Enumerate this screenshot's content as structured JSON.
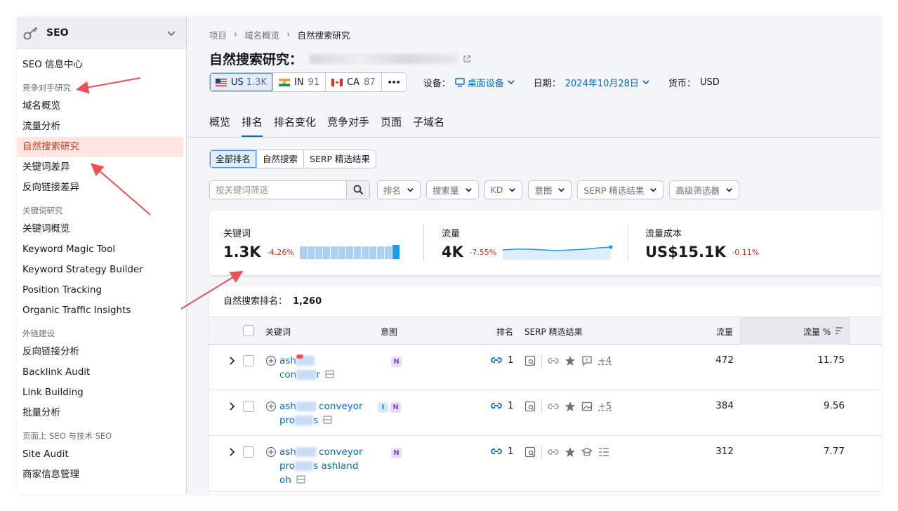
{
  "sidebar": {
    "title": "SEO",
    "items": [
      {
        "type": "item",
        "label": "SEO 信息中心"
      },
      {
        "type": "section",
        "label": "竞争对手研究"
      },
      {
        "type": "item",
        "label": "域名概览"
      },
      {
        "type": "item",
        "label": "流量分析"
      },
      {
        "type": "item",
        "label": "自然搜索研究",
        "active": true
      },
      {
        "type": "item",
        "label": "关键词差异"
      },
      {
        "type": "item",
        "label": "反向链接差异"
      },
      {
        "type": "section",
        "label": "关键词研究"
      },
      {
        "type": "item",
        "label": "关键词概览"
      },
      {
        "type": "item",
        "label": "Keyword Magic Tool"
      },
      {
        "type": "item",
        "label": "Keyword Strategy Builder"
      },
      {
        "type": "item",
        "label": "Position Tracking"
      },
      {
        "type": "item",
        "label": "Organic Traffic Insights"
      },
      {
        "type": "section",
        "label": "外链建设"
      },
      {
        "type": "item",
        "label": "反向链接分析"
      },
      {
        "type": "item",
        "label": "Backlink Audit"
      },
      {
        "type": "item",
        "label": "Link Building"
      },
      {
        "type": "item",
        "label": "批量分析"
      },
      {
        "type": "section",
        "label": "页面上 SEO 与技术 SEO"
      },
      {
        "type": "item",
        "label": "Site Audit"
      },
      {
        "type": "item",
        "label": "商家信息管理"
      }
    ]
  },
  "breadcrumb": [
    "项目",
    "域名概览",
    "自然搜索研究"
  ],
  "page_title": "自然搜索研究：",
  "databases": [
    {
      "code": "US",
      "count": "1.3K",
      "selected": true
    },
    {
      "code": "IN",
      "count": "91"
    },
    {
      "code": "CA",
      "count": "87"
    }
  ],
  "more_label": "•••",
  "device": {
    "label": "设备：",
    "value": "桌面设备"
  },
  "date": {
    "label": "日期：",
    "value": "2024年10月28日"
  },
  "currency": {
    "label": "货币：",
    "value": "USD"
  },
  "tabs": [
    "概览",
    "排名",
    "排名变化",
    "竞争对手",
    "页面",
    "子域名"
  ],
  "active_tab": 1,
  "segments": [
    "全部排名",
    "自然搜索",
    "SERP 精选结果"
  ],
  "filters": {
    "search_placeholder": "按关键词筛选",
    "buttons": [
      "排名",
      "搜索量",
      "KD",
      "意图",
      "SERP 精选结果",
      "高级筛选器"
    ]
  },
  "summary": {
    "keywords": {
      "label": "关键词",
      "value": "1.3K",
      "delta": "-4.26%"
    },
    "traffic": {
      "label": "流量",
      "value": "4K",
      "delta": "-7.55%"
    },
    "traffic_cost": {
      "label": "流量成本",
      "value": "US$15.1K",
      "delta": "-0.11%"
    }
  },
  "table": {
    "count_label": "自然搜索排名：",
    "count_value": "1,260",
    "headers": {
      "keyword": "关键词",
      "intent": "意图",
      "position": "排名",
      "serp": "SERP 精选结果",
      "traffic": "流量",
      "traffic_pct": "流量 %"
    },
    "rows": [
      {
        "kw_line1": "ash",
        "kw_line2a": "con",
        "kw_line2b": "r",
        "intents": [
          "N"
        ],
        "position": "1",
        "serp_more": "+4",
        "traffic": "472",
        "traffic_pct": "11.75"
      },
      {
        "kw_line1": "ash",
        "kw_line1b": "conveyor",
        "kw_line2a": "pro",
        "kw_line2b": "s",
        "intents": [
          "I",
          "N"
        ],
        "position": "1",
        "serp_more": "+5",
        "traffic": "384",
        "traffic_pct": "9.56"
      },
      {
        "kw_line1": "ash",
        "kw_line1b": "conveyor",
        "kw_line2a": "pro",
        "kw_line2b": "s ashland",
        "kw_line3": "oh",
        "intents": [
          "N"
        ],
        "position": "1",
        "serp_more": "",
        "traffic": "312",
        "traffic_pct": "7.77"
      }
    ]
  },
  "colors": {
    "accent": "#006dca",
    "active_bg": "#ffe6de",
    "active_text": "#d1311c",
    "annotation_arrow": "#ef4f58"
  }
}
